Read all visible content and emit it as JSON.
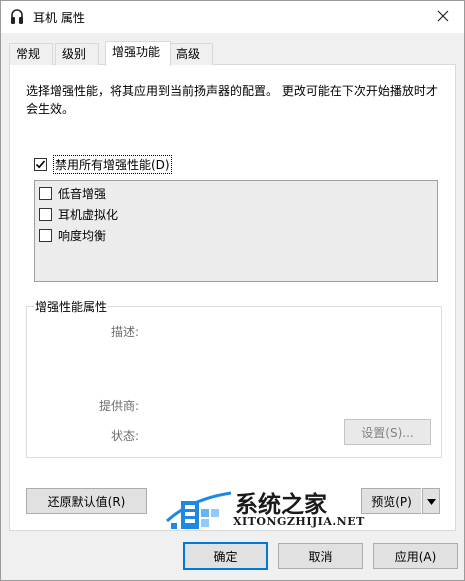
{
  "window": {
    "title": "耳机 属性",
    "icon": "headphone-icon",
    "close_icon": "close-icon"
  },
  "tabs": [
    {
      "label": "常规",
      "active": false
    },
    {
      "label": "级别",
      "active": false
    },
    {
      "label": "增强功能",
      "active": true
    },
    {
      "label": "高级",
      "active": false
    }
  ],
  "enhancements": {
    "description": "选择增强性能，将其应用到当前扬声器的配置。 更改可能在下次开始播放时才会生效。",
    "disable_all": {
      "label": "禁用所有增强性能(D)",
      "checked": true
    },
    "items": [
      {
        "label": "低音增强",
        "checked": false
      },
      {
        "label": "耳机虚拟化",
        "checked": false
      },
      {
        "label": "响度均衡",
        "checked": false
      }
    ]
  },
  "properties": {
    "group_title": "增强性能属性",
    "description_label": "描述:",
    "provider_label": "提供商:",
    "status_label": "状态:",
    "settings_button": "设置(S)..."
  },
  "actions": {
    "restore_defaults": "还原默认值(R)",
    "preview": "预览(P)",
    "preview_dropdown_icon": "dropdown-arrow-icon"
  },
  "footer": {
    "ok": "确定",
    "cancel": "取消",
    "apply": "应用(A)"
  },
  "watermark": {
    "text": "系统之家",
    "url": "XITONGZHIJIA.NET"
  },
  "colors": {
    "accent": "#0078d7",
    "watermark_blue": "#1e88e5"
  }
}
